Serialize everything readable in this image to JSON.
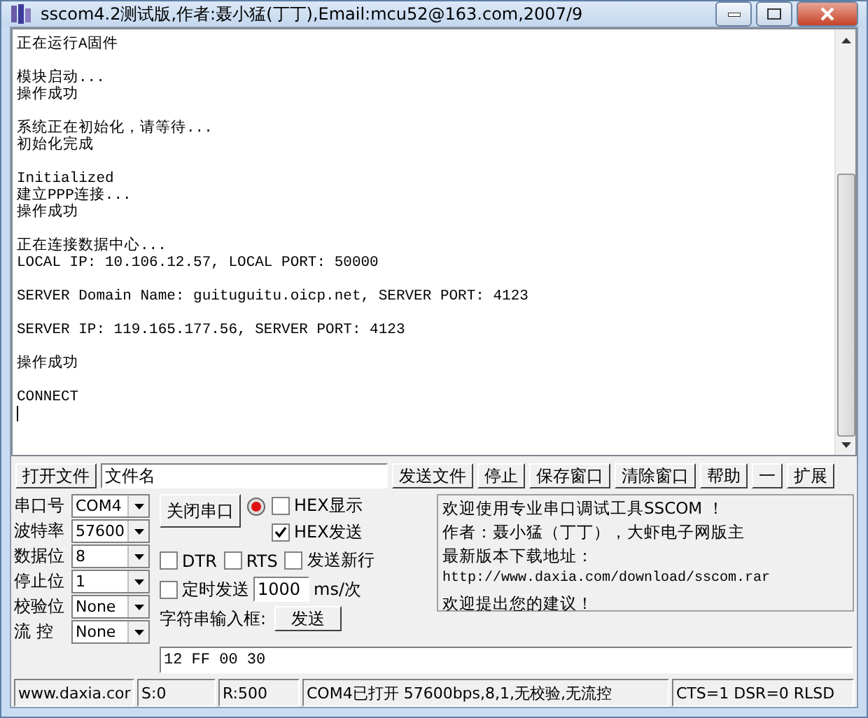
{
  "window": {
    "title": "sscom4.2测试版,作者:聂小猛(丁丁),Email:mcu52@163.com,2007/9"
  },
  "terminal": {
    "blocks": [
      [
        "正在运行A固件"
      ],
      [
        "模块启动...",
        "操作成功"
      ],
      [
        "系统正在初始化，请等待...",
        "初始化完成"
      ],
      [
        "Initialized",
        "建立PPP连接...",
        "操作成功"
      ],
      [
        "正在连接数据中心...",
        "LOCAL IP: 10.106.12.57, LOCAL PORT: 50000"
      ],
      [
        "SERVER Domain Name: guituguitu.oicp.net, SERVER PORT: 4123"
      ],
      [
        "SERVER IP: 119.165.177.56, SERVER PORT: 4123"
      ],
      [
        "操作成功"
      ],
      [
        "CONNECT"
      ]
    ]
  },
  "file_bar": {
    "open_button": "打开文件",
    "file_name": "文件名",
    "buttons": [
      "发送文件",
      "停止",
      "保存窗口",
      "清除窗口",
      "帮助",
      "一",
      "扩展"
    ]
  },
  "port_settings": [
    {
      "label": "串口号",
      "value": "COM4"
    },
    {
      "label": "波特率",
      "value": "57600"
    },
    {
      "label": "数据位",
      "value": "8"
    },
    {
      "label": "停止位",
      "value": "1"
    },
    {
      "label": "校验位",
      "value": "None"
    },
    {
      "label": "流 控",
      "value": "None"
    }
  ],
  "close_port_button": "关闭串口",
  "port_open": true,
  "options": {
    "hex_display": {
      "label": "HEX显示",
      "checked": false
    },
    "hex_send": {
      "label": "HEX发送",
      "checked": true
    },
    "dtr": {
      "label": "DTR",
      "checked": false
    },
    "rts": {
      "label": "RTS",
      "checked": false
    },
    "send_newline": {
      "label": "发送新行",
      "checked": false
    },
    "timed_send": {
      "label": "定时发送",
      "checked": false
    }
  },
  "interval": {
    "value": "1000",
    "unit": "ms/次"
  },
  "string_input_label": "字符串输入框:",
  "send_button": "发送",
  "send_input": "12 FF 00 30",
  "info": [
    "欢迎使用专业串口调试工具SSCOM ！",
    "作者：聂小猛（丁丁），大虾电子网版主",
    "最新版本下载地址：",
    "http://www.daxia.com/download/sscom.rar",
    "欢迎提出您的建议！"
  ],
  "status_bar": [
    "www.daxia.cor",
    "S:0",
    "R:500",
    "COM4已打开  57600bps,8,1,无校验,无流控",
    "CTS=1 DSR=0 RLSD"
  ]
}
